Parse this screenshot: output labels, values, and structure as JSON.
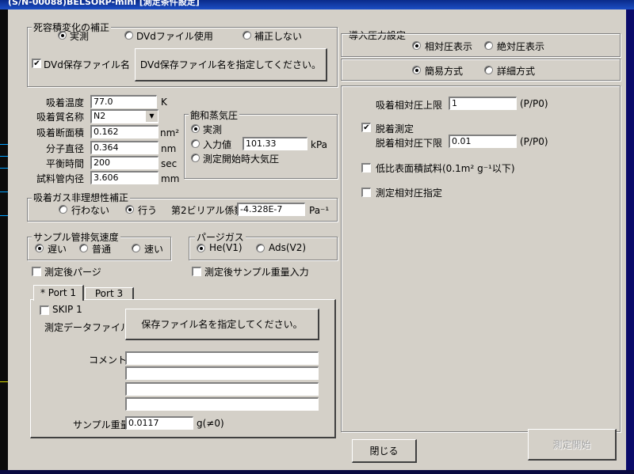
{
  "window": {
    "title": "(S/N-00088)BELSORP-mini [測定条件設定]"
  },
  "dead_volume": {
    "title": "死容積変化の補正",
    "options": [
      "実測",
      "DVdファイル使用",
      "補正しない"
    ],
    "selected": 0,
    "dvd_save_label": "DVd保存ファイル名",
    "dvd_save_checked": true,
    "dvd_button": "DVd保存ファイル名を指定してください。"
  },
  "params": {
    "temp_label": "吸着温度",
    "temp_value": "77.0",
    "temp_unit": "K",
    "gas_label": "吸着質名称",
    "gas_value": "N2",
    "area_label": "吸着断面積",
    "area_value": "0.162",
    "area_unit": "nm²",
    "diam_label": "分子直径",
    "diam_value": "0.364",
    "diam_unit": "nm",
    "eq_label": "平衡時間",
    "eq_value": "200",
    "eq_unit": "sec",
    "tube_label": "試料管内径",
    "tube_value": "3.606",
    "tube_unit": "mm"
  },
  "saturation": {
    "title": "飽和蒸気圧",
    "options": [
      "実測",
      "入力値",
      "測定開始時大気圧"
    ],
    "selected": 0,
    "input_value": "101.33",
    "unit": "kPa"
  },
  "nonideal": {
    "title": "吸着ガス非理想性補正",
    "options": [
      "行わない",
      "行う"
    ],
    "selected": 1,
    "coef_label": "第2ビリアル係数",
    "coef_value": "-4.328E-7",
    "coef_unit": "Pa⁻¹"
  },
  "exhaust": {
    "title": "サンプル管排気速度",
    "options": [
      "遅い",
      "普通",
      "速い"
    ],
    "selected": 0
  },
  "purge": {
    "title": "パージガス",
    "options": [
      "He(V1)",
      "Ads(V2)"
    ],
    "selected": 0
  },
  "checks": {
    "after_purge": "測定後パージ",
    "after_weight": "測定後サンプル重量入力"
  },
  "tabs": [
    "* Port 1",
    "Port 3"
  ],
  "port": {
    "skip_label": "SKIP 1",
    "datafile_label": "測定データファイル名",
    "datafile_button": "保存ファイル名を指定してください。",
    "comment_label": "コメント",
    "weight_label": "サンプル重量",
    "weight_value": "0.0117",
    "weight_unit": "g(≠0)"
  },
  "pressure": {
    "title": "導入圧力設定",
    "display_options": [
      "相対圧表示",
      "絶対圧表示"
    ],
    "display_selected": 0,
    "mode_options": [
      "簡易方式",
      "詳細方式"
    ],
    "mode_selected": 0,
    "upper_label": "吸着相対圧上限",
    "upper_value": "1",
    "upper_unit": "(P/P0)",
    "desorb_label": "脱着測定",
    "desorb_checked": true,
    "lower_label": "脱着相対圧下限",
    "lower_value": "0.01",
    "lower_unit": "(P/P0)",
    "low_area_label": "低比表面積試料(0.1m² g⁻¹以下)",
    "rel_spec_label": "測定相対圧指定"
  },
  "buttons": {
    "close": "閉じる",
    "start": "測定開始"
  }
}
